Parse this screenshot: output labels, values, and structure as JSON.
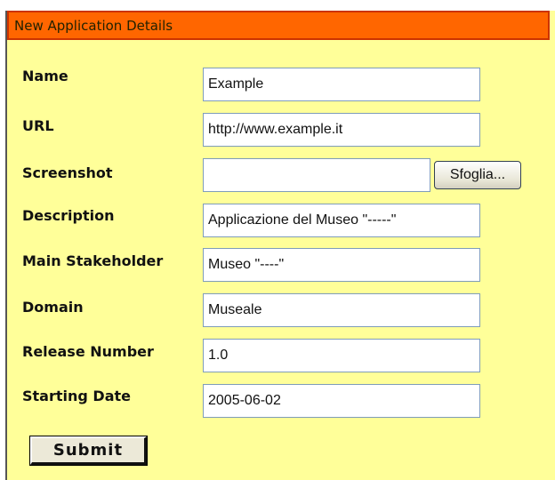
{
  "header": {
    "title": "New Application Details"
  },
  "form": {
    "fields": [
      {
        "label": "Name",
        "value": "Example"
      },
      {
        "label": "URL",
        "value": "http://www.example.it"
      },
      {
        "label": "Screenshot",
        "value": ""
      },
      {
        "label": "Description",
        "value": "Applicazione del Museo \"-----\""
      },
      {
        "label": "Main Stakeholder",
        "value": "Museo \"----\""
      },
      {
        "label": "Domain",
        "value": "Museale"
      },
      {
        "label": "Release Number",
        "value": "1.0"
      },
      {
        "label": "Starting Date",
        "value": "2005-06-02"
      }
    ],
    "browse_label": "Sfoglia...",
    "submit_label": "Submit"
  },
  "colors": {
    "panel_background": "#ffff99",
    "header_background": "#ff6600",
    "header_border": "#cc3300"
  }
}
